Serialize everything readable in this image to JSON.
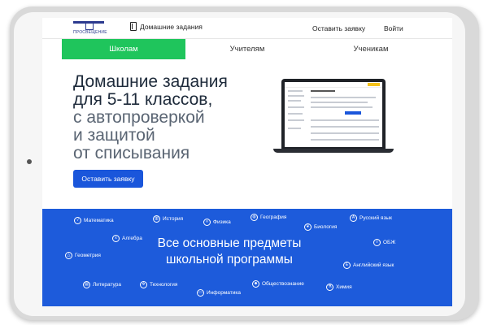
{
  "header": {
    "logo_text": "ПРОСВЕЩЕНИЕ",
    "title": "Домашние задания",
    "links": [
      "Оставить заявку",
      "Войти"
    ]
  },
  "tabs": [
    {
      "label": "Школам",
      "active": true
    },
    {
      "label": "Учителям",
      "active": false
    },
    {
      "label": "Ученикам",
      "active": false
    }
  ],
  "hero": {
    "title_lines": [
      "Домашние задания",
      "для 5-11 классов,",
      "с автопроверкой",
      "и защитой",
      "от списывания"
    ],
    "cta": "Оставить заявку"
  },
  "subjects_section": {
    "title_lines": [
      "Все основные предметы",
      "школьной программы"
    ],
    "subjects": [
      "Математика",
      "История",
      "Физика",
      "География",
      "Биология",
      "Русский язык",
      "Алгебра",
      "ОБЖ",
      "Геометрия",
      "Английский язык",
      "Литература",
      "Технология",
      "Информатика",
      "Обществознание",
      "Химия"
    ]
  },
  "colors": {
    "accent_green": "#1fc55c",
    "primary_blue": "#1d5bdb"
  }
}
